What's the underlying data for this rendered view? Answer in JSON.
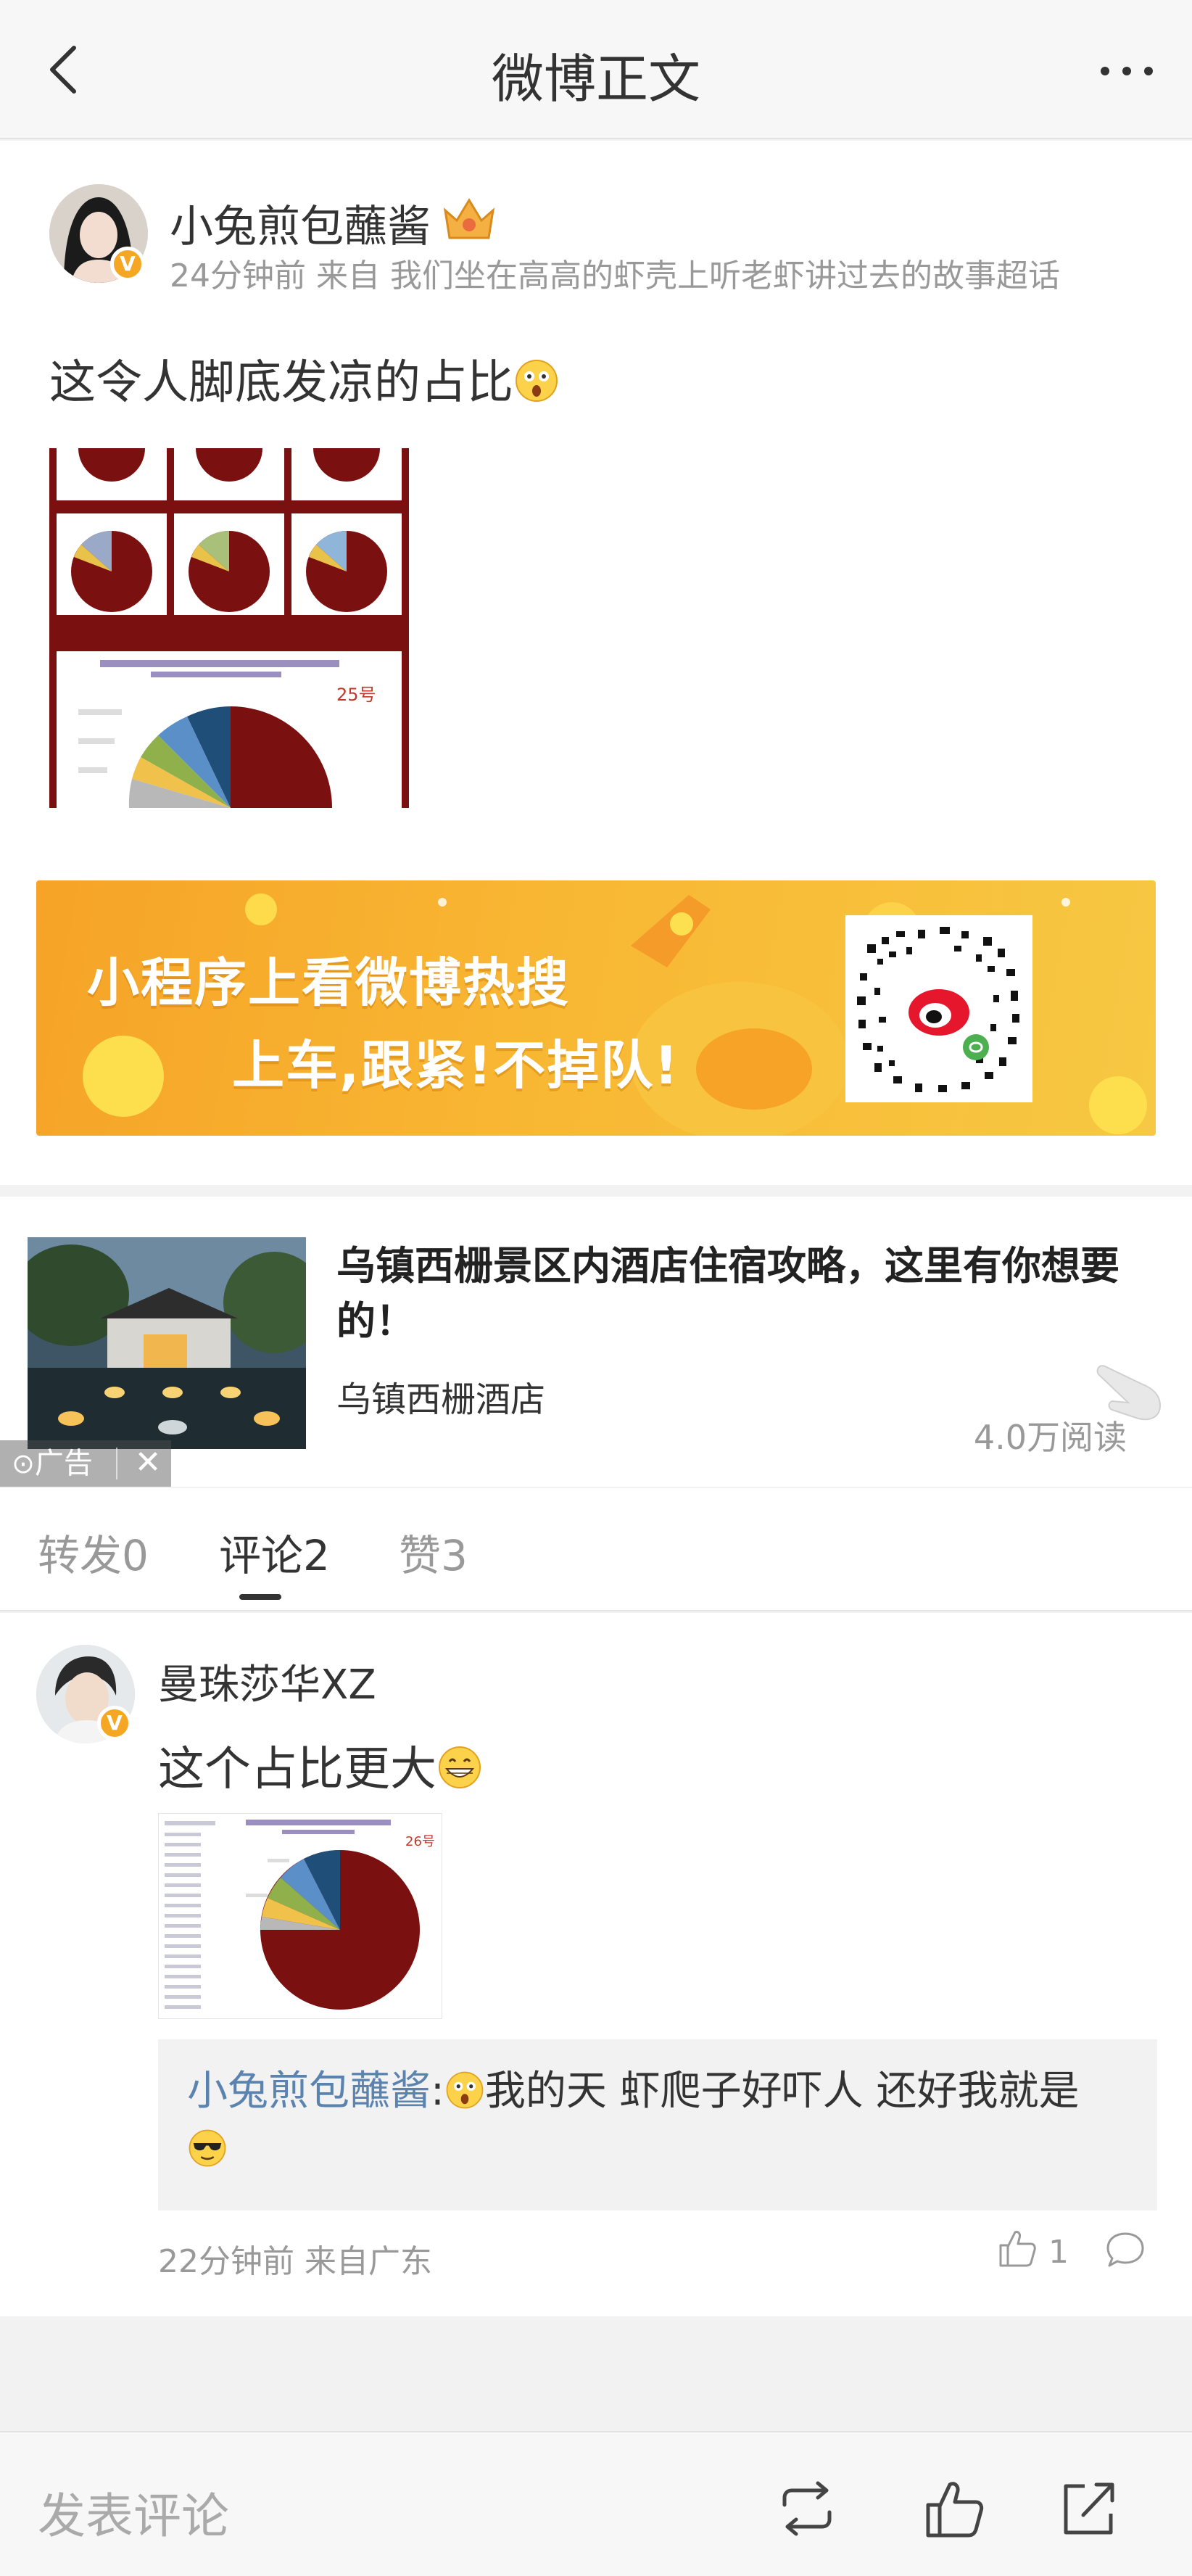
{
  "nav": {
    "title": "微博正文",
    "back_icon": "chevron-left-icon",
    "more_icon": "more-horizontal-icon"
  },
  "post": {
    "username": "小兔煎包蘸酱",
    "verified_badge": "V",
    "meta": "24分钟前 来自 我们坐在高高的虾壳上听老虾讲过去的故事超话",
    "text": "这令人脚底发凉的占比",
    "image_number_label": "25号"
  },
  "banner": {
    "line1": "小程序上看微博热搜",
    "line2": "上车,跟紧!不掉队!"
  },
  "ad": {
    "title": "乌镇西栅景区内酒店住宿攻略，这里有你想要的！",
    "subtitle": "乌镇西栅酒店",
    "reads": "4.0万阅读",
    "label": "广告",
    "close": "✕"
  },
  "tabs": [
    {
      "label": "转发0"
    },
    {
      "label": "评论2"
    },
    {
      "label": "赞3"
    }
  ],
  "comment": {
    "username": "曼珠莎华XZ",
    "verified_badge": "V",
    "text": "这个占比更大",
    "image_number_label": "26号",
    "reply": {
      "name": "小兔煎包蘸酱",
      "separator": ":",
      "text": "我的天 虾爬子好吓人 还好我就是"
    },
    "meta": "22分钟前 来自广东",
    "likes": "1"
  },
  "bottom_bar": {
    "comment_placeholder": "发表评论"
  },
  "colors": {
    "accent_blue": "#5b83b0",
    "banner_orange": "#f6a327",
    "pie_red": "#7b1010",
    "badge_orange": "#f5a623"
  }
}
